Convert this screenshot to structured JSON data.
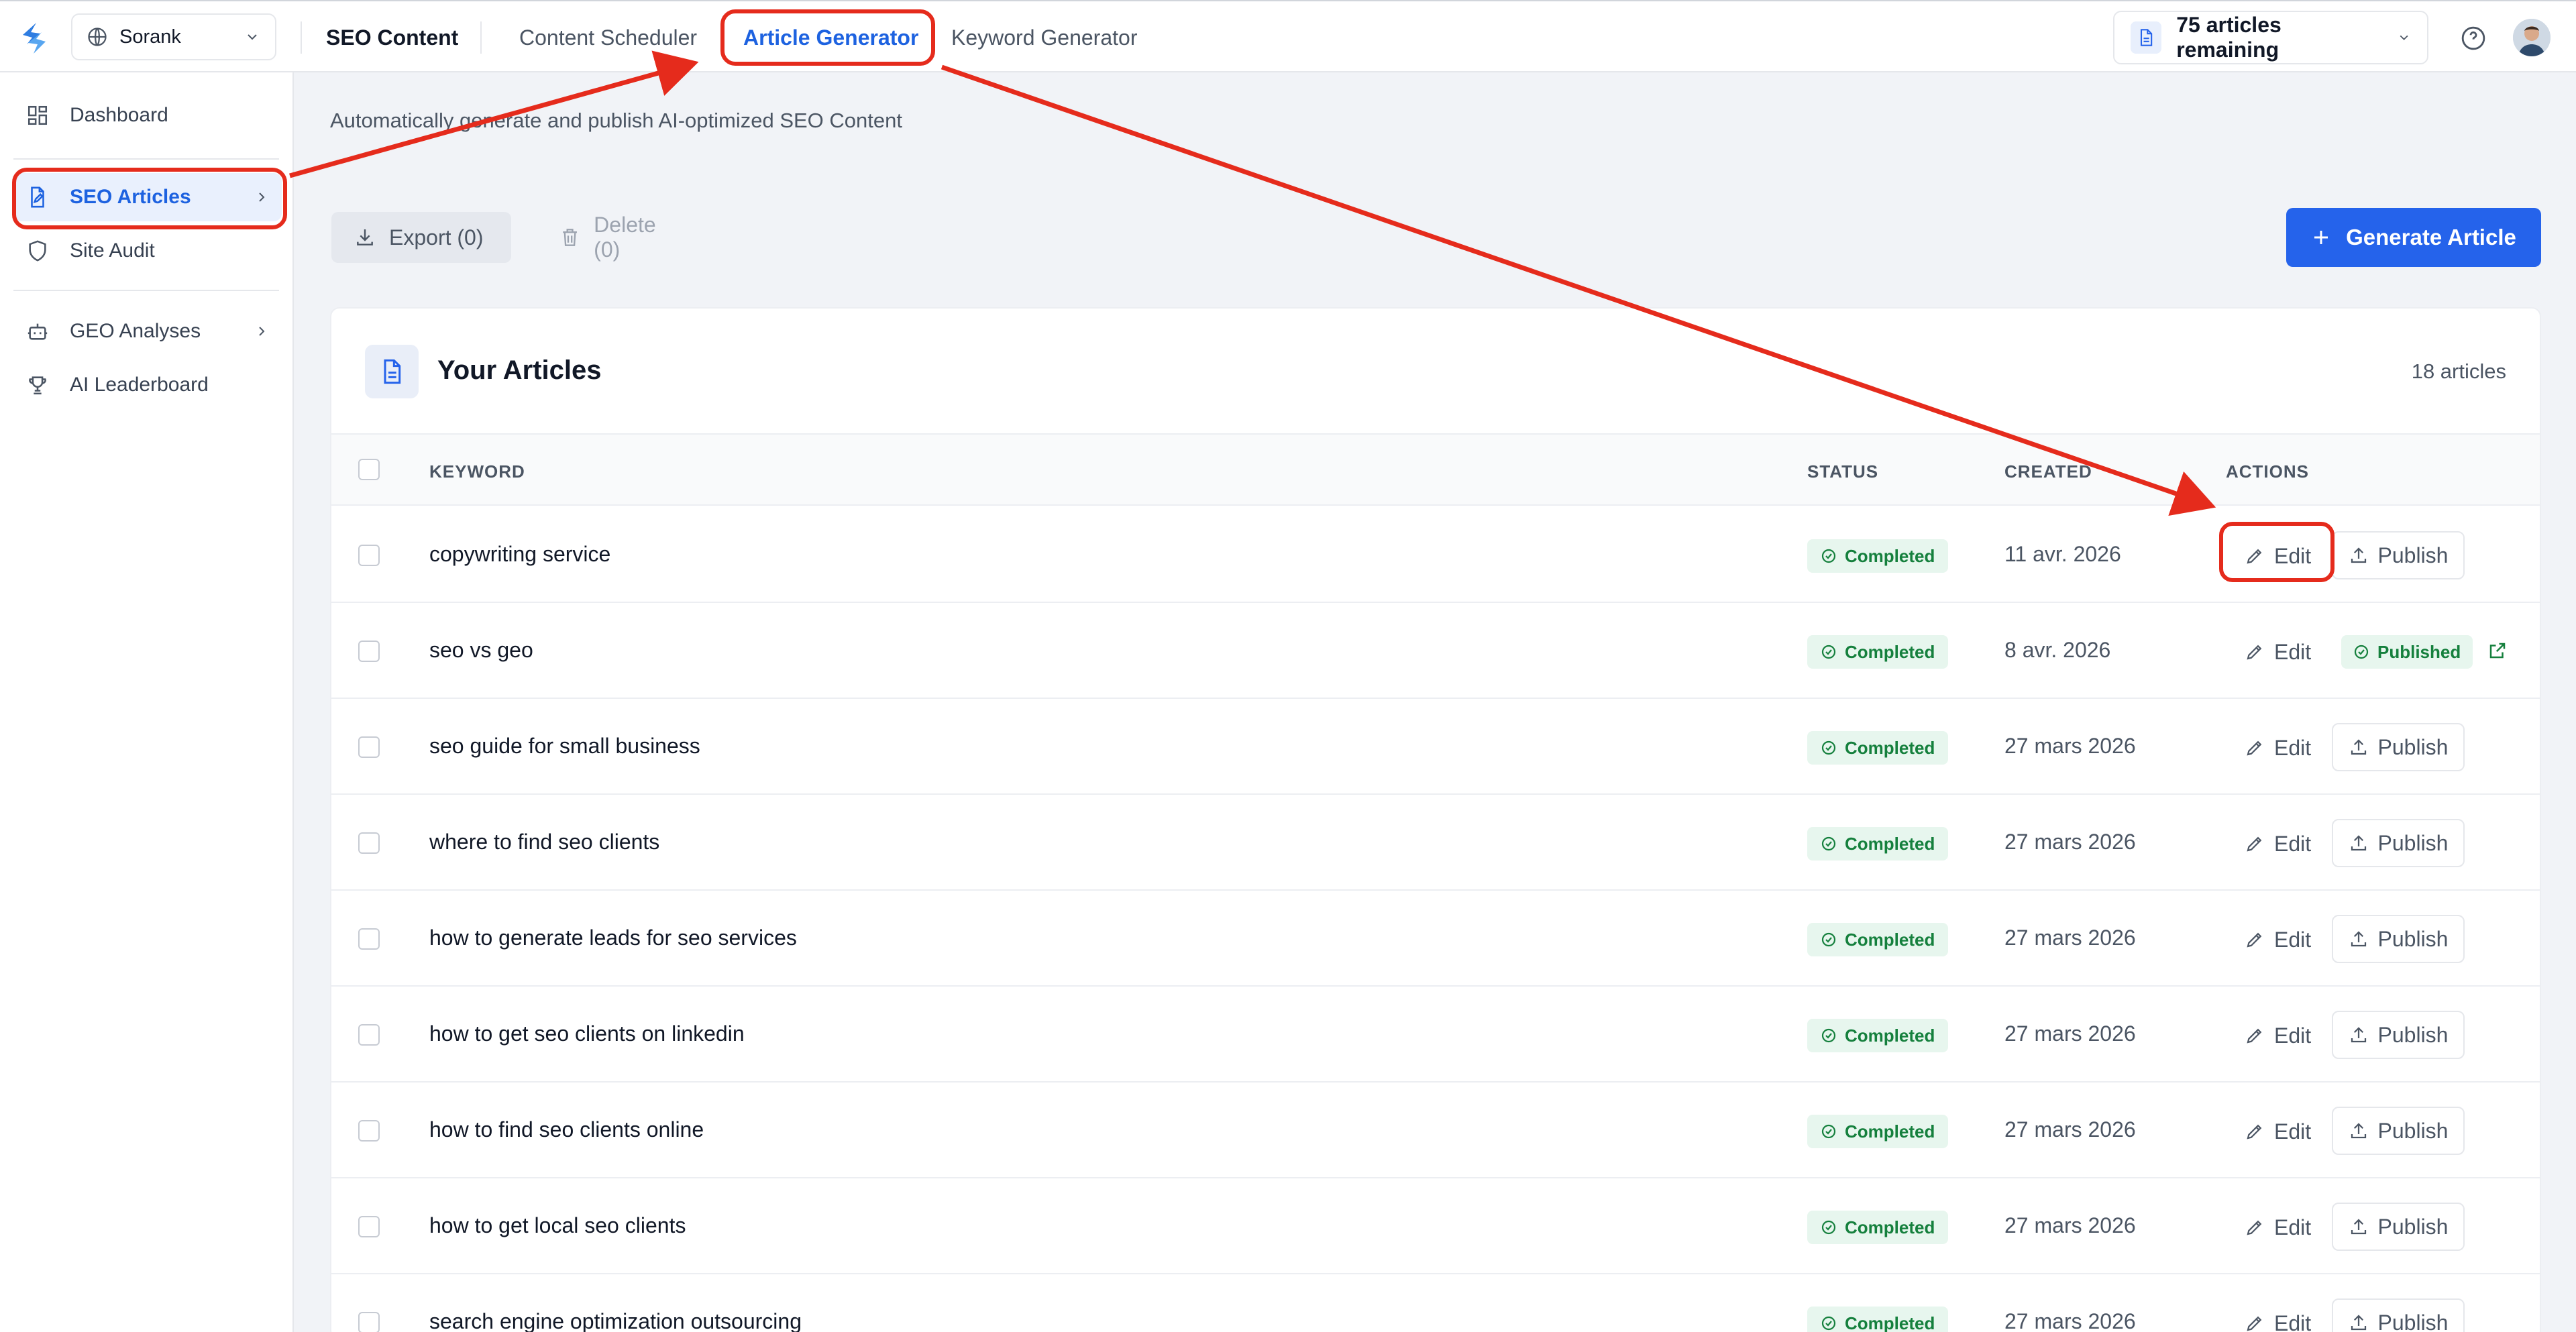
{
  "topbar": {
    "workspace": "Sorank",
    "section_title": "SEO Content",
    "nav": [
      {
        "label": "Content Scheduler"
      },
      {
        "label": "Article Generator"
      },
      {
        "label": "Keyword Generator"
      }
    ],
    "remaining": "75 articles remaining"
  },
  "sidebar": {
    "items": [
      {
        "label": "Dashboard"
      },
      {
        "label": "SEO Articles"
      },
      {
        "label": "Site Audit"
      },
      {
        "label": "GEO Analyses"
      },
      {
        "label": "AI Leaderboard"
      }
    ]
  },
  "main": {
    "subtitle": "Automatically generate and publish AI-optimized SEO Content",
    "export_label": "Export (0)",
    "delete_label": "Delete (0)",
    "generate_label": "Generate Article"
  },
  "card": {
    "title": "Your Articles",
    "count": "18 articles",
    "columns": {
      "keyword": "KEYWORD",
      "status": "STATUS",
      "created": "CREATED",
      "actions": "ACTIONS"
    }
  },
  "labels": {
    "edit": "Edit",
    "publish": "Publish",
    "published": "Published"
  },
  "rows": [
    {
      "keyword": "copywriting service",
      "status": "Completed",
      "created": "11 avr. 2026",
      "published": false
    },
    {
      "keyword": "seo vs geo",
      "status": "Completed",
      "created": "8 avr. 2026",
      "published": true
    },
    {
      "keyword": "seo guide for small business",
      "status": "Completed",
      "created": "27 mars 2026",
      "published": false
    },
    {
      "keyword": "where to find seo clients",
      "status": "Completed",
      "created": "27 mars 2026",
      "published": false
    },
    {
      "keyword": "how to generate leads for seo services",
      "status": "Completed",
      "created": "27 mars 2026",
      "published": false
    },
    {
      "keyword": "how to get seo clients on linkedin",
      "status": "Completed",
      "created": "27 mars 2026",
      "published": false
    },
    {
      "keyword": "how to find seo clients online",
      "status": "Completed",
      "created": "27 mars 2026",
      "published": false
    },
    {
      "keyword": "how to get local seo clients",
      "status": "Completed",
      "created": "27 mars 2026",
      "published": false
    },
    {
      "keyword": "search engine optimization outsourcing",
      "status": "Completed",
      "created": "27 mars 2026",
      "published": false
    }
  ],
  "colors": {
    "accent": "#2563eb",
    "annotation": "#e52b1c",
    "success": "#15803d"
  }
}
